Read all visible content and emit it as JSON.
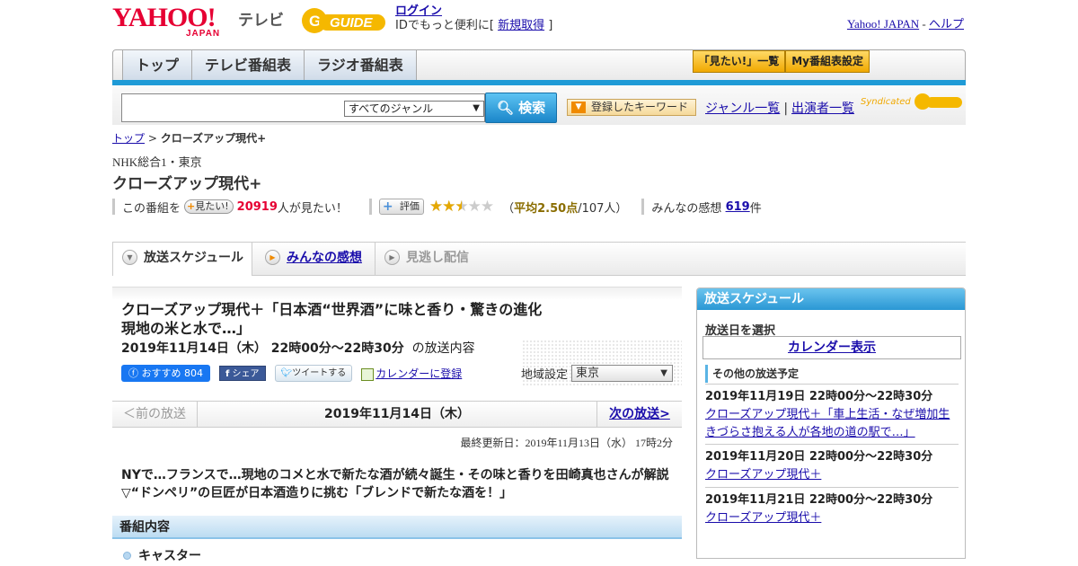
{
  "header": {
    "logo_yahoo": "YAHOO!",
    "logo_japan": "JAPAN",
    "logo_tv": "テレビ",
    "logo_gguide": "GUIDE",
    "login_link": "ログイン",
    "login_text_pre": "IDでもっと便利に[ ",
    "register_link": "新規取得",
    "login_text_post": " ]",
    "yahoo_japan_link": "Yahoo! JAPAN",
    "sep": " - ",
    "help_link": "ヘルプ"
  },
  "nav": {
    "tabs": [
      {
        "label": "トップ"
      },
      {
        "label": "テレビ番組表"
      },
      {
        "label": "ラジオ番組表"
      }
    ],
    "mitai_list": "「見たい!」一覧",
    "my_program": "My番組表設定"
  },
  "search": {
    "genre_selected": "すべてのジャンル",
    "search_button": "検索",
    "keyword_button": "登録したキーワード",
    "genre_list_link": "ジャンル一覧",
    "divider": "|",
    "performer_link": "出演者一覧",
    "syndicated": "Syndicated"
  },
  "breadcrumb": {
    "top": "トップ",
    "sep": " > ",
    "current": "クローズアップ現代+"
  },
  "program": {
    "channel": "NHK総合1・東京",
    "title": "クローズアップ現代+"
  },
  "stats": {
    "prefix": "この番組を",
    "mitai_button": "見たい!",
    "mitai_count": "20919",
    "mitai_suffix": "人が見たい！",
    "rating_button": "評価",
    "rating_value": 2.5,
    "rating_max": 5,
    "avg_open": "（",
    "avg_text": "平均2.50点",
    "avg_count": "/107人）",
    "impressions_prefix": "みんなの感想",
    "impressions_count": "619",
    "impressions_suffix": "件"
  },
  "page_tabs": {
    "schedule": "放送スケジュール",
    "impressions": "みんなの感想",
    "missed": "見逃し配信"
  },
  "episode": {
    "title": "クローズアップ現代＋「日本酒“世界酒”に味と香り・驚きの進化現地の米と水で…」",
    "time_bold": "2019年11月14日（木） 22時00分～22時30分",
    "time_suffix": "の放送内容",
    "fb_recommend": "おすすめ 804",
    "fb_share": "シェア",
    "tweet": "ツイートする",
    "calendar_register": "カレンダーに登録",
    "region_label": "地域設定",
    "region_value": "東京"
  },
  "pager": {
    "prev": "＜前の放送",
    "current": "2019年11月14日（木）",
    "next": "次の放送>"
  },
  "updated": "最終更新日：2019年11月13日（水） 17時2分",
  "description": "NYで…フランスで…現地のコメと水で新たな酒が続々誕生・その味と香りを田崎真也さんが解説▽“ドンペリ”の巨匠が日本酒造りに挑む「ブレンドで新たな酒を！」",
  "content_section": {
    "heading": "番組内容",
    "cast_label": "キャスター"
  },
  "sidebar": {
    "heading": "放送スケジュール",
    "select_label": "放送日を選択",
    "calendar_button": "カレンダー表示",
    "other_heading": "その他の放送予定",
    "schedules": [
      {
        "date": "2019年11月19日 22時00分～22時30分",
        "title": "クローズアップ現代＋「車上生活・なぜ増加生きづらさ抱える人が各地の道の駅で…」"
      },
      {
        "date": "2019年11月20日 22時00分～22時30分",
        "title": "クローズアップ現代＋"
      },
      {
        "date": "2019年11月21日 22時00分～22時30分",
        "title": "クローズアップ現代＋"
      }
    ]
  },
  "colors": {
    "accent_blue": "#1e9ad6",
    "link": "#1a0dab",
    "red": "#e60033",
    "star": "#e5a800"
  }
}
